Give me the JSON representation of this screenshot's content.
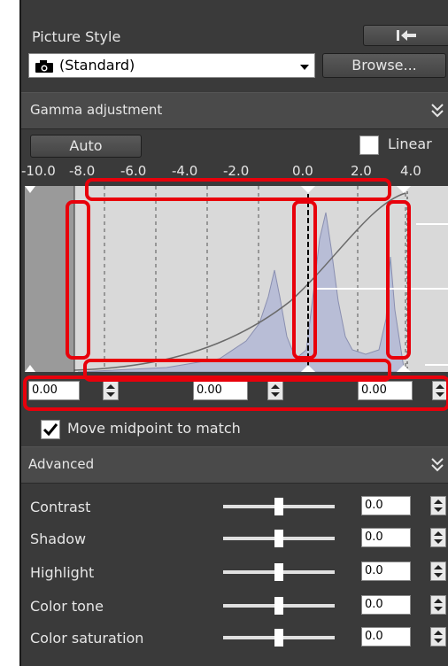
{
  "picture_style": {
    "title": "Picture Style",
    "selected": "(Standard)",
    "browse_label": "Browse..."
  },
  "gamma": {
    "section_title": "Gamma adjustment",
    "auto_label": "Auto",
    "linear_label": "Linear",
    "linear_checked": false,
    "scale_ticks": [
      "-10.0",
      "-8.0",
      "-6.0",
      "-4.0",
      "-2.0",
      "0.0",
      "2.0",
      "4.0"
    ],
    "left_value": "0.00",
    "mid_value": "0.00",
    "right_value": "0.00",
    "move_midpoint_label": "Move midpoint to match",
    "move_midpoint_checked": true
  },
  "advanced": {
    "section_title": "Advanced",
    "rows": [
      {
        "label": "Contrast",
        "value": "0.0",
        "level": 0
      },
      {
        "label": "Shadow",
        "value": "0.0",
        "level": 0
      },
      {
        "label": "Highlight",
        "value": "0.0",
        "level": 0
      },
      {
        "label": "Color tone",
        "value": "0.0",
        "level": 0
      },
      {
        "label": "Color saturation",
        "value": "0.0",
        "level": 0
      }
    ]
  },
  "colors": {
    "panel_bg": "#3a3a3a",
    "annotation_red": "#e8000b",
    "histogram_fill": "#b8bdd6"
  }
}
